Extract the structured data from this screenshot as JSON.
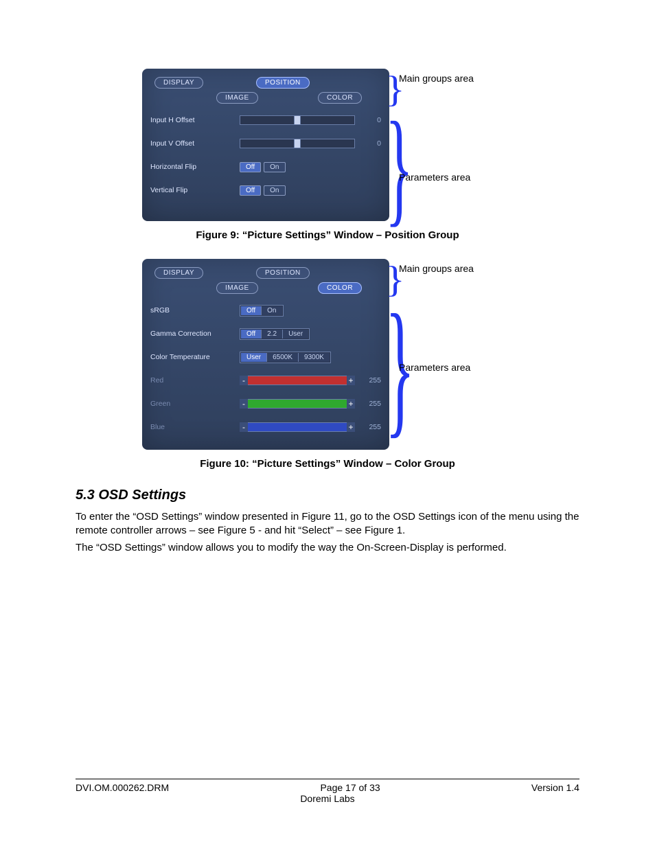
{
  "figure9": {
    "tabs": {
      "display": "DISPLAY",
      "position": "POSITION",
      "image": "IMAGE",
      "color": "COLOR"
    },
    "rows": {
      "hoffset": {
        "label": "Input H Offset",
        "value": "0"
      },
      "voffset": {
        "label": "Input V Offset",
        "value": "0"
      },
      "hflip": {
        "label": "Horizontal Flip",
        "off": "Off",
        "on": "On"
      },
      "vflip": {
        "label": "Vertical Flip",
        "off": "Off",
        "on": "On"
      }
    },
    "anno": {
      "groups": "Main groups area",
      "params": "Parameters area"
    },
    "caption": "Figure 9: “Picture Settings” Window – Position Group"
  },
  "figure10": {
    "tabs": {
      "display": "DISPLAY",
      "position": "POSITION",
      "image": "IMAGE",
      "color": "COLOR"
    },
    "rows": {
      "srgb": {
        "label": "sRGB",
        "off": "Off",
        "on": "On"
      },
      "gamma": {
        "label": "Gamma Correction",
        "off": "Off",
        "v22": "2.2",
        "user": "User"
      },
      "ctemp": {
        "label": "Color Temperature",
        "user": "User",
        "k6500": "6500K",
        "k9300": "9300K"
      },
      "red": {
        "label": "Red",
        "value": "255"
      },
      "green": {
        "label": "Green",
        "value": "255"
      },
      "blue": {
        "label": "Blue",
        "value": "255"
      }
    },
    "anno": {
      "groups": "Main groups area",
      "params": "Parameters area"
    },
    "caption": "Figure 10: “Picture Settings” Window – Color Group"
  },
  "section": {
    "heading": "5.3  OSD Settings",
    "para1": "To enter the “OSD Settings” window presented in Figure 11, go to the OSD Settings icon of the menu using the remote controller arrows – see Figure 5 - and hit “Select” – see Figure 1.",
    "para2": "The “OSD Settings” window allows you to modify the way the On-Screen-Display is performed."
  },
  "footer": {
    "left": "DVI.OM.000262.DRM",
    "center": "Page 17 of 33",
    "sub": "Doremi Labs",
    "right": "Version 1.4"
  }
}
